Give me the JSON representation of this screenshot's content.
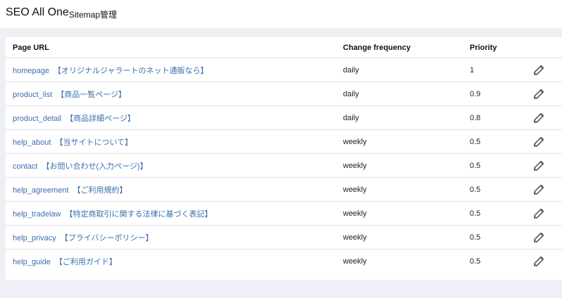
{
  "header": {
    "app_title": "SEO All One",
    "page_subtitle": "Sitemap管理"
  },
  "table": {
    "columns": {
      "page_url": "Page URL",
      "change_frequency": "Change frequency",
      "priority": "Priority"
    },
    "rows": [
      {
        "path": "homepage",
        "label": "【オリジナルジャラートのネット通販なら】",
        "frequency": "daily",
        "priority": "1"
      },
      {
        "path": "product_list",
        "label": "【商品一覧ページ】",
        "frequency": "daily",
        "priority": "0.9"
      },
      {
        "path": "product_detail",
        "label": "【商品詳細ページ】",
        "frequency": "daily",
        "priority": "0.8"
      },
      {
        "path": "help_about",
        "label": "【当サイトについて】",
        "frequency": "weekly",
        "priority": "0.5"
      },
      {
        "path": "contact",
        "label": "【お問い合わせ(入力ページ)】",
        "frequency": "weekly",
        "priority": "0.5"
      },
      {
        "path": "help_agreement",
        "label": "【ご利用規約】",
        "frequency": "weekly",
        "priority": "0.5"
      },
      {
        "path": "help_tradelaw",
        "label": "【特定商取引に関する法律に基づく表記】",
        "frequency": "weekly",
        "priority": "0.5"
      },
      {
        "path": "help_privacy",
        "label": "【プライバシーポリシー】",
        "frequency": "weekly",
        "priority": "0.5"
      },
      {
        "path": "help_guide",
        "label": "【ご利用ガイド】",
        "frequency": "weekly",
        "priority": "0.5"
      }
    ],
    "action_icon": "pencil-icon"
  },
  "colors": {
    "link": "#3a6fb0",
    "background": "#eef0f5",
    "card": "#ffffff",
    "icon": "#555555"
  }
}
